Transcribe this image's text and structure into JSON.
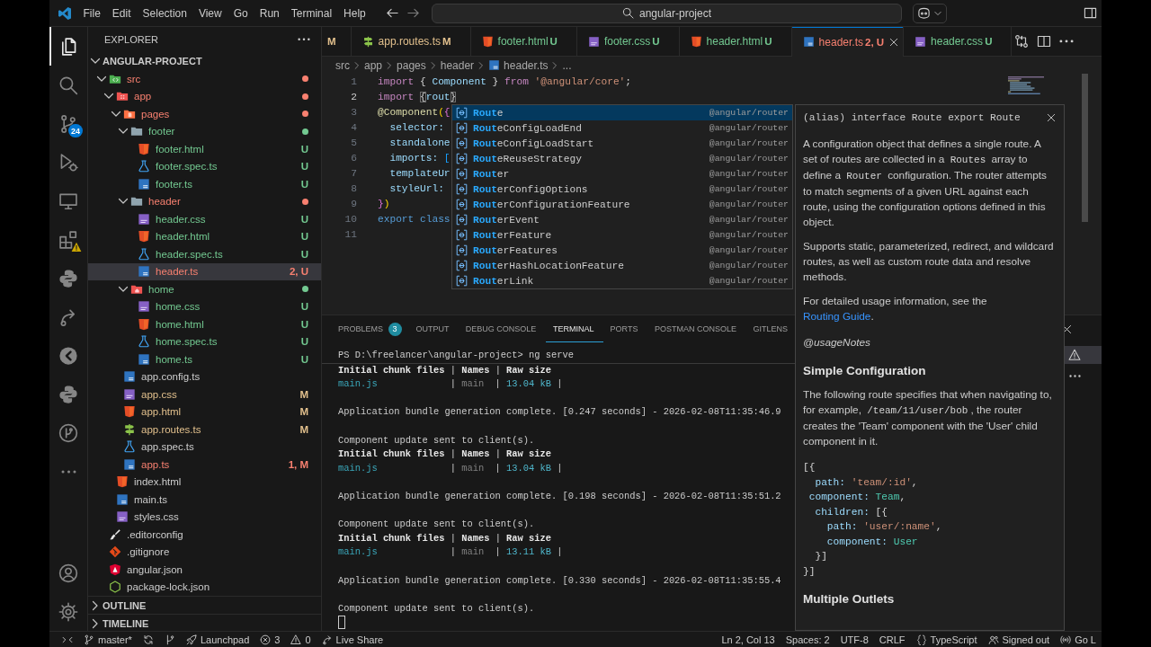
{
  "title_bar": {
    "menu": [
      "File",
      "Edit",
      "Selection",
      "View",
      "Go",
      "Run",
      "Terminal",
      "Help"
    ],
    "search": {
      "value": "angular-project"
    }
  },
  "activity_bar": {
    "items": [
      {
        "kind": "explorer",
        "selected": true
      },
      {
        "kind": "search",
        "selected": false
      },
      {
        "kind": "source-control",
        "selected": false,
        "badge": {
          "kind": "count",
          "text": "24"
        }
      },
      {
        "kind": "run-debug",
        "selected": false
      },
      {
        "kind": "remote-explorer",
        "selected": false
      },
      {
        "kind": "extensions",
        "selected": false,
        "badge": {
          "kind": "warning"
        }
      },
      {
        "kind": "python",
        "selected": false
      },
      {
        "kind": "live-share",
        "selected": false
      },
      {
        "kind": "inspect",
        "selected": false
      },
      {
        "kind": "python",
        "selected": false
      },
      {
        "kind": "git-graph",
        "selected": false
      },
      {
        "kind": "more",
        "selected": false
      }
    ],
    "bottom": [
      {
        "kind": "account"
      },
      {
        "kind": "settings"
      }
    ]
  },
  "sidebar": {
    "title": "EXPLORER",
    "project": {
      "label": "ANGULAR-PROJECT",
      "expanded": true
    },
    "tree": [
      {
        "label": "src",
        "kind": "folder-src",
        "color": "#f88070",
        "expanded": true,
        "selected": false,
        "children": [
          {
            "label": "app",
            "kind": "folder-app",
            "color": "#f88070",
            "expanded": true,
            "selected": false,
            "children": [
              {
                "label": "pages",
                "kind": "folder-pages",
                "color": "#f88070",
                "expanded": true,
                "selected": false,
                "children": [
                  {
                    "label": "footer",
                    "kind": "folder",
                    "color": "#73c991",
                    "expanded": true,
                    "selected": false,
                    "children": [
                      {
                        "label": "footer.html",
                        "kind": "html",
                        "color": "#73c991",
                        "badge": "U",
                        "selected": false
                      },
                      {
                        "label": "footer.spec.ts",
                        "kind": "spec",
                        "color": "#73c991",
                        "badge": "U",
                        "selected": false
                      },
                      {
                        "label": "footer.ts",
                        "kind": "ts",
                        "color": "#73c991",
                        "badge": "U",
                        "selected": false
                      }
                    ]
                  },
                  {
                    "label": "header",
                    "kind": "folder",
                    "color": "#f88070",
                    "expanded": true,
                    "selected": false,
                    "children": [
                      {
                        "label": "header.css",
                        "kind": "css",
                        "color": "#73c991",
                        "badge": "U",
                        "selected": false
                      },
                      {
                        "label": "header.html",
                        "kind": "html",
                        "color": "#73c991",
                        "badge": "U",
                        "selected": false
                      },
                      {
                        "label": "header.spec.ts",
                        "kind": "spec",
                        "color": "#73c991",
                        "badge": "U",
                        "selected": false
                      },
                      {
                        "label": "header.ts",
                        "kind": "ts",
                        "color": "#f88070",
                        "badge": "2, U",
                        "selected": true
                      }
                    ]
                  },
                  {
                    "label": "home",
                    "kind": "folder-home",
                    "color": "#73c991",
                    "expanded": true,
                    "selected": false,
                    "children": [
                      {
                        "label": "home.css",
                        "kind": "css",
                        "color": "#73c991",
                        "badge": "U",
                        "selected": false
                      },
                      {
                        "label": "home.html",
                        "kind": "html",
                        "color": "#73c991",
                        "badge": "U",
                        "selected": false
                      },
                      {
                        "label": "home.spec.ts",
                        "kind": "spec",
                        "color": "#73c991",
                        "badge": "U",
                        "selected": false
                      },
                      {
                        "label": "home.ts",
                        "kind": "ts",
                        "color": "#73c991",
                        "badge": "U",
                        "selected": false
                      }
                    ]
                  }
                ]
              },
              {
                "label": "app.config.ts",
                "kind": "ts",
                "selected": false
              },
              {
                "label": "app.css",
                "kind": "css",
                "color": "#e2c08d",
                "badge": "M",
                "selected": false
              },
              {
                "label": "app.html",
                "kind": "html",
                "color": "#e2c08d",
                "badge": "M",
                "selected": false
              },
              {
                "label": "app.routes.ts",
                "kind": "routes",
                "color": "#e2c08d",
                "badge": "M",
                "selected": false
              },
              {
                "label": "app.spec.ts",
                "kind": "spec",
                "selected": false
              },
              {
                "label": "app.ts",
                "kind": "ts",
                "color": "#f88070",
                "badge": "1, M",
                "selected": false
              }
            ]
          },
          {
            "label": "index.html",
            "kind": "html",
            "selected": false
          },
          {
            "label": "main.ts",
            "kind": "ts",
            "selected": false
          },
          {
            "label": "styles.css",
            "kind": "css",
            "selected": false
          }
        ]
      },
      {
        "label": ".editorconfig",
        "kind": "editorconfig",
        "selected": false
      },
      {
        "label": ".gitignore",
        "kind": "gitignore",
        "selected": false
      },
      {
        "label": "angular.json",
        "kind": "angular",
        "selected": false
      },
      {
        "label": "package-lock.json",
        "kind": "json",
        "selected": false
      }
    ],
    "sections": [
      {
        "label": "OUTLINE",
        "expanded": false
      },
      {
        "label": "TIMELINE",
        "expanded": false
      }
    ]
  },
  "editor_tabs": [
    {
      "badge": "M",
      "color": "#e2c08d",
      "selected": false
    },
    {
      "label": "app.routes.ts",
      "kind": "routes",
      "badge": "M",
      "color": "#e2c08d",
      "selected": false
    },
    {
      "label": "footer.html",
      "kind": "html",
      "badge": "U",
      "color": "#73c991",
      "selected": false
    },
    {
      "label": "footer.css",
      "kind": "css",
      "badge": "U",
      "color": "#73c991",
      "selected": false
    },
    {
      "label": "header.html",
      "kind": "html",
      "badge": "U",
      "color": "#73c991",
      "selected": false
    },
    {
      "label": "header.ts",
      "kind": "ts",
      "badge": "2, U",
      "color": "#f88070",
      "selected": true
    },
    {
      "label": "header.css",
      "kind": "css",
      "badge": "U",
      "color": "#73c991",
      "selected": false
    }
  ],
  "breadcrumb": [
    {
      "label": "src"
    },
    {
      "label": "app"
    },
    {
      "label": "pages"
    },
    {
      "label": "header"
    },
    {
      "label": "header.ts",
      "kind": "ts"
    },
    {
      "label": "..."
    }
  ],
  "editor": {
    "lines": [
      {
        "number": "1",
        "current": false,
        "tokens": [
          {
            "text": "import ",
            "kind": "keyword"
          },
          {
            "text": "{ ",
            "kind": "punct"
          },
          {
            "text": "Component",
            "kind": "variable"
          },
          {
            "text": " } ",
            "kind": "punct"
          },
          {
            "text": "from ",
            "kind": "keyword"
          },
          {
            "text": "'@angular/core'",
            "kind": "string"
          },
          {
            "text": ";",
            "kind": "punct"
          }
        ]
      },
      {
        "number": "2",
        "current": true,
        "tokens": [
          {
            "text": "import ",
            "kind": "keyword"
          },
          {
            "text": "{",
            "kind": "bracket-match"
          },
          {
            "text": "rout",
            "kind": "variable"
          },
          {
            "text": "}",
            "kind": "bracket-match"
          }
        ]
      },
      {
        "number": "3",
        "current": false,
        "tokens": [
          {
            "text": "@Component",
            "kind": "decorator"
          },
          {
            "text": "(",
            "kind": "bracket1"
          },
          {
            "text": "{",
            "kind": "bracket2"
          }
        ]
      },
      {
        "number": "4",
        "current": false,
        "tokens": [
          {
            "text": "  selector:",
            "kind": "property"
          }
        ]
      },
      {
        "number": "5",
        "current": false,
        "tokens": [
          {
            "text": "  standalone",
            "kind": "property"
          }
        ]
      },
      {
        "number": "6",
        "current": false,
        "tokens": [
          {
            "text": "  imports:",
            "kind": "property"
          },
          {
            "text": " [",
            "kind": "bracket3"
          }
        ]
      },
      {
        "number": "7",
        "current": false,
        "tokens": [
          {
            "text": "  templateUr",
            "kind": "property"
          }
        ]
      },
      {
        "number": "8",
        "current": false,
        "tokens": [
          {
            "text": "  styleUrl:",
            "kind": "property"
          }
        ]
      },
      {
        "number": "9",
        "current": false,
        "tokens": [
          {
            "text": "}",
            "kind": "bracket2"
          },
          {
            "text": ")",
            "kind": "bracket1"
          }
        ]
      },
      {
        "number": "10",
        "current": false,
        "tokens": [
          {
            "text": "export ",
            "kind": "storage"
          },
          {
            "text": "class",
            "kind": "storage"
          }
        ]
      },
      {
        "number": "11",
        "current": false
      }
    ]
  },
  "suggest": {
    "items": [
      {
        "label": "**Rout**e",
        "detail": "@angular/router",
        "selected": true
      },
      {
        "label": "**Rout**eConfigLoadEnd",
        "detail": "@angular/router",
        "selected": false
      },
      {
        "label": "**Rout**eConfigLoadStart",
        "detail": "@angular/router",
        "selected": false
      },
      {
        "label": "**Rout**eReuseStrategy",
        "detail": "@angular/router",
        "selected": false
      },
      {
        "label": "**Rout**er",
        "detail": "@angular/router",
        "selected": false
      },
      {
        "label": "**Rout**erConfigOptions",
        "detail": "@angular/router",
        "selected": false
      },
      {
        "label": "**Rout**erConfigurationFeature",
        "detail": "@angular/router",
        "selected": false
      },
      {
        "label": "**Rout**erEvent",
        "detail": "@angular/router",
        "selected": false
      },
      {
        "label": "**Rout**erFeature",
        "detail": "@angular/router",
        "selected": false
      },
      {
        "label": "**Rout**erFeatures",
        "detail": "@angular/router",
        "selected": false
      },
      {
        "label": "**Rout**erHashLocationFeature",
        "detail": "@angular/router",
        "selected": false
      },
      {
        "label": "**Rout**erLink",
        "detail": "@angular/router",
        "selected": false
      }
    ]
  },
  "hover": {
    "signature": "(alias) interface Route export Route",
    "blocks": [
      {
        "kind": "paragraph",
        "segments": [
          {
            "kind": "text",
            "text": "A configuration object that defines a single route. A set of routes are collected in a "
          },
          {
            "kind": "code",
            "text": "Routes"
          },
          {
            "kind": "text",
            "text": " array to define a "
          },
          {
            "kind": "code",
            "text": "Router"
          },
          {
            "kind": "text",
            "text": " configuration. The router attempts to match segments of a given URL against each route, using the configuration options defined in this object."
          }
        ]
      },
      {
        "kind": "paragraph",
        "segments": [
          {
            "kind": "text",
            "text": "Supports static, parameterized, redirect, and wildcard routes, as well as custom route data and resolve methods."
          }
        ]
      },
      {
        "kind": "paragraph",
        "segments": [
          {
            "kind": "text",
            "text": "For detailed usage information, see the "
          },
          {
            "kind": "link",
            "text": "Routing Guide"
          },
          {
            "kind": "text",
            "text": "."
          }
        ]
      },
      {
        "kind": "tag",
        "text": "@usageNotes"
      },
      {
        "kind": "heading",
        "text": "Simple Configuration"
      },
      {
        "kind": "paragraph",
        "segments": [
          {
            "kind": "text",
            "text": "The following route specifies that when navigating to, for example, "
          },
          {
            "kind": "code",
            "text": "/team/11/user/bob"
          },
          {
            "kind": "text",
            "text": ", the router creates the 'Team' component with the 'User' child component in it."
          }
        ]
      },
      {
        "kind": "code",
        "lines": [
          {
            "tokens": [
              {
                "text": "[{",
                "kind": "punct"
              }
            ]
          },
          {
            "tokens": [
              {
                "text": "  path: ",
                "kind": "property"
              },
              {
                "text": "'team/:id'",
                "kind": "string"
              },
              {
                "text": ",",
                "kind": "punct"
              }
            ]
          },
          {
            "tokens": [
              {
                "text": " component: ",
                "kind": "property"
              },
              {
                "text": "Team",
                "kind": "type"
              },
              {
                "text": ",",
                "kind": "punct"
              }
            ]
          },
          {
            "tokens": [
              {
                "text": "  children: ",
                "kind": "property"
              },
              {
                "text": "[{",
                "kind": "punct"
              }
            ]
          },
          {
            "tokens": [
              {
                "text": "    path: ",
                "kind": "property"
              },
              {
                "text": "'user/:name'",
                "kind": "string"
              },
              {
                "text": ",",
                "kind": "punct"
              }
            ]
          },
          {
            "tokens": [
              {
                "text": "    component: ",
                "kind": "property"
              },
              {
                "text": "User",
                "kind": "type"
              }
            ]
          },
          {
            "tokens": [
              {
                "text": "  }]",
                "kind": "punct"
              }
            ]
          },
          {
            "tokens": [
              {
                "text": "}]",
                "kind": "punct"
              }
            ]
          }
        ]
      },
      {
        "kind": "heading",
        "text": "Multiple Outlets"
      }
    ]
  },
  "panel": {
    "tabs": [
      {
        "label": "PROBLEMS",
        "badge": "3",
        "selected": false
      },
      {
        "label": "OUTPUT",
        "selected": false
      },
      {
        "label": "DEBUG CONSOLE",
        "selected": false
      },
      {
        "label": "TERMINAL",
        "selected": true
      },
      {
        "label": "PORTS",
        "selected": false
      },
      {
        "label": "POSTMAN CONSOLE",
        "selected": false
      },
      {
        "label": "GITLENS",
        "selected": false
      }
    ],
    "terminal": {
      "prompt": "PS D:\\freelancer\\angular-project> ng serve",
      "blocks": [
        {
          "lines": [
            {
              "segments": [
                {
                  "text": "Initial chunk files",
                  "kind": "bold"
                },
                {
                  "text": " | ",
                  "kind": "plain"
                },
                {
                  "text": "Names",
                  "kind": "bold"
                },
                {
                  "text": " | ",
                  "kind": "plain"
                },
                {
                  "text": "Raw size",
                  "kind": "bold"
                }
              ]
            },
            {
              "segments": [
                {
                  "text": "main.js",
                  "kind": "file"
                },
                {
                  "text": "             | ",
                  "kind": "plain"
                },
                {
                  "text": "main",
                  "kind": "dim"
                },
                {
                  "text": "  | ",
                  "kind": "plain"
                },
                {
                  "text": "13.04 kB",
                  "kind": "size"
                },
                {
                  "text": " |",
                  "kind": "plain"
                }
              ]
            }
          ]
        },
        {
          "lines": [
            {
              "segments": [
                {
                  "text": "Application bundle generation complete. [0.247 seconds] - 2026-02-08T11:35:46.9",
                  "kind": "plain"
                }
              ]
            }
          ]
        },
        {
          "lines": [
            {
              "segments": [
                {
                  "text": "Component update sent to client(s).",
                  "kind": "plain"
                }
              ]
            },
            {
              "segments": [
                {
                  "text": "Initial chunk files",
                  "kind": "bold"
                },
                {
                  "text": " | ",
                  "kind": "plain"
                },
                {
                  "text": "Names",
                  "kind": "bold"
                },
                {
                  "text": " | ",
                  "kind": "plain"
                },
                {
                  "text": "Raw size",
                  "kind": "bold"
                }
              ]
            },
            {
              "segments": [
                {
                  "text": "main.js",
                  "kind": "file"
                },
                {
                  "text": "             | ",
                  "kind": "plain"
                },
                {
                  "text": "main",
                  "kind": "dim"
                },
                {
                  "text": "  | ",
                  "kind": "plain"
                },
                {
                  "text": "13.04 kB",
                  "kind": "size"
                },
                {
                  "text": " |",
                  "kind": "plain"
                }
              ]
            }
          ]
        },
        {
          "lines": [
            {
              "segments": [
                {
                  "text": "Application bundle generation complete. [0.198 seconds] - 2026-02-08T11:35:51.2",
                  "kind": "plain"
                }
              ]
            }
          ]
        },
        {
          "lines": [
            {
              "segments": [
                {
                  "text": "Component update sent to client(s).",
                  "kind": "plain"
                }
              ]
            },
            {
              "segments": [
                {
                  "text": "Initial chunk files",
                  "kind": "bold"
                },
                {
                  "text": " | ",
                  "kind": "plain"
                },
                {
                  "text": "Names",
                  "kind": "bold"
                },
                {
                  "text": " | ",
                  "kind": "plain"
                },
                {
                  "text": "Raw size",
                  "kind": "bold"
                }
              ]
            },
            {
              "segments": [
                {
                  "text": "main.js",
                  "kind": "file"
                },
                {
                  "text": "             | ",
                  "kind": "plain"
                },
                {
                  "text": "main",
                  "kind": "dim"
                },
                {
                  "text": "  | ",
                  "kind": "plain"
                },
                {
                  "text": "13.11 kB",
                  "kind": "size"
                },
                {
                  "text": " |",
                  "kind": "plain"
                }
              ]
            }
          ]
        },
        {
          "lines": [
            {
              "segments": [
                {
                  "text": "Application bundle generation complete. [0.330 seconds] - 2026-02-08T11:35:55.4",
                  "kind": "plain"
                }
              ]
            }
          ]
        },
        {
          "lines": [
            {
              "segments": [
                {
                  "text": "Component update sent to client(s).",
                  "kind": "plain"
                }
              ]
            }
          ]
        }
      ]
    }
  },
  "status_bar": {
    "left": [
      {
        "kind": "remote"
      },
      {
        "kind": "branch",
        "text": "master*"
      },
      {
        "kind": "sync"
      },
      {
        "kind": "graph"
      },
      {
        "kind": "launchpad",
        "text": "Launchpad"
      },
      {
        "kind": "errors",
        "text": "3"
      },
      {
        "kind": "warnings",
        "text": "0"
      },
      {
        "kind": "live-share",
        "text": "Live Share"
      }
    ],
    "right": [
      {
        "kind": "plain",
        "text": "Ln 2, Col 13"
      },
      {
        "kind": "plain",
        "text": "Spaces: 2"
      },
      {
        "kind": "plain",
        "text": "UTF-8"
      },
      {
        "kind": "plain",
        "text": "CRLF"
      },
      {
        "kind": "language",
        "text": "TypeScript"
      },
      {
        "kind": "account",
        "text": "Signed out"
      },
      {
        "kind": "broadcast",
        "text": "Go L"
      }
    ]
  }
}
